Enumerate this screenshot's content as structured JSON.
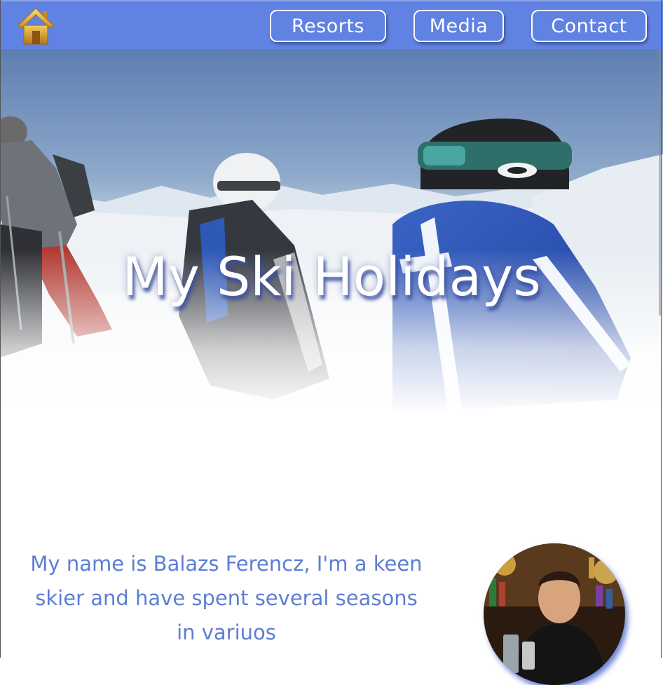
{
  "nav": {
    "home_icon": "home-icon",
    "resorts_label": "Resorts",
    "media_label": "Media",
    "contact_label": "Contact"
  },
  "hero": {
    "title": "My Ski Holidays"
  },
  "intro": {
    "text": "My name is Balazs Ferencz, I'm a keen skier and have spent several seasons in variuos"
  },
  "colors": {
    "navbar": "#6083e3",
    "accent_text": "#5c7ed4"
  }
}
